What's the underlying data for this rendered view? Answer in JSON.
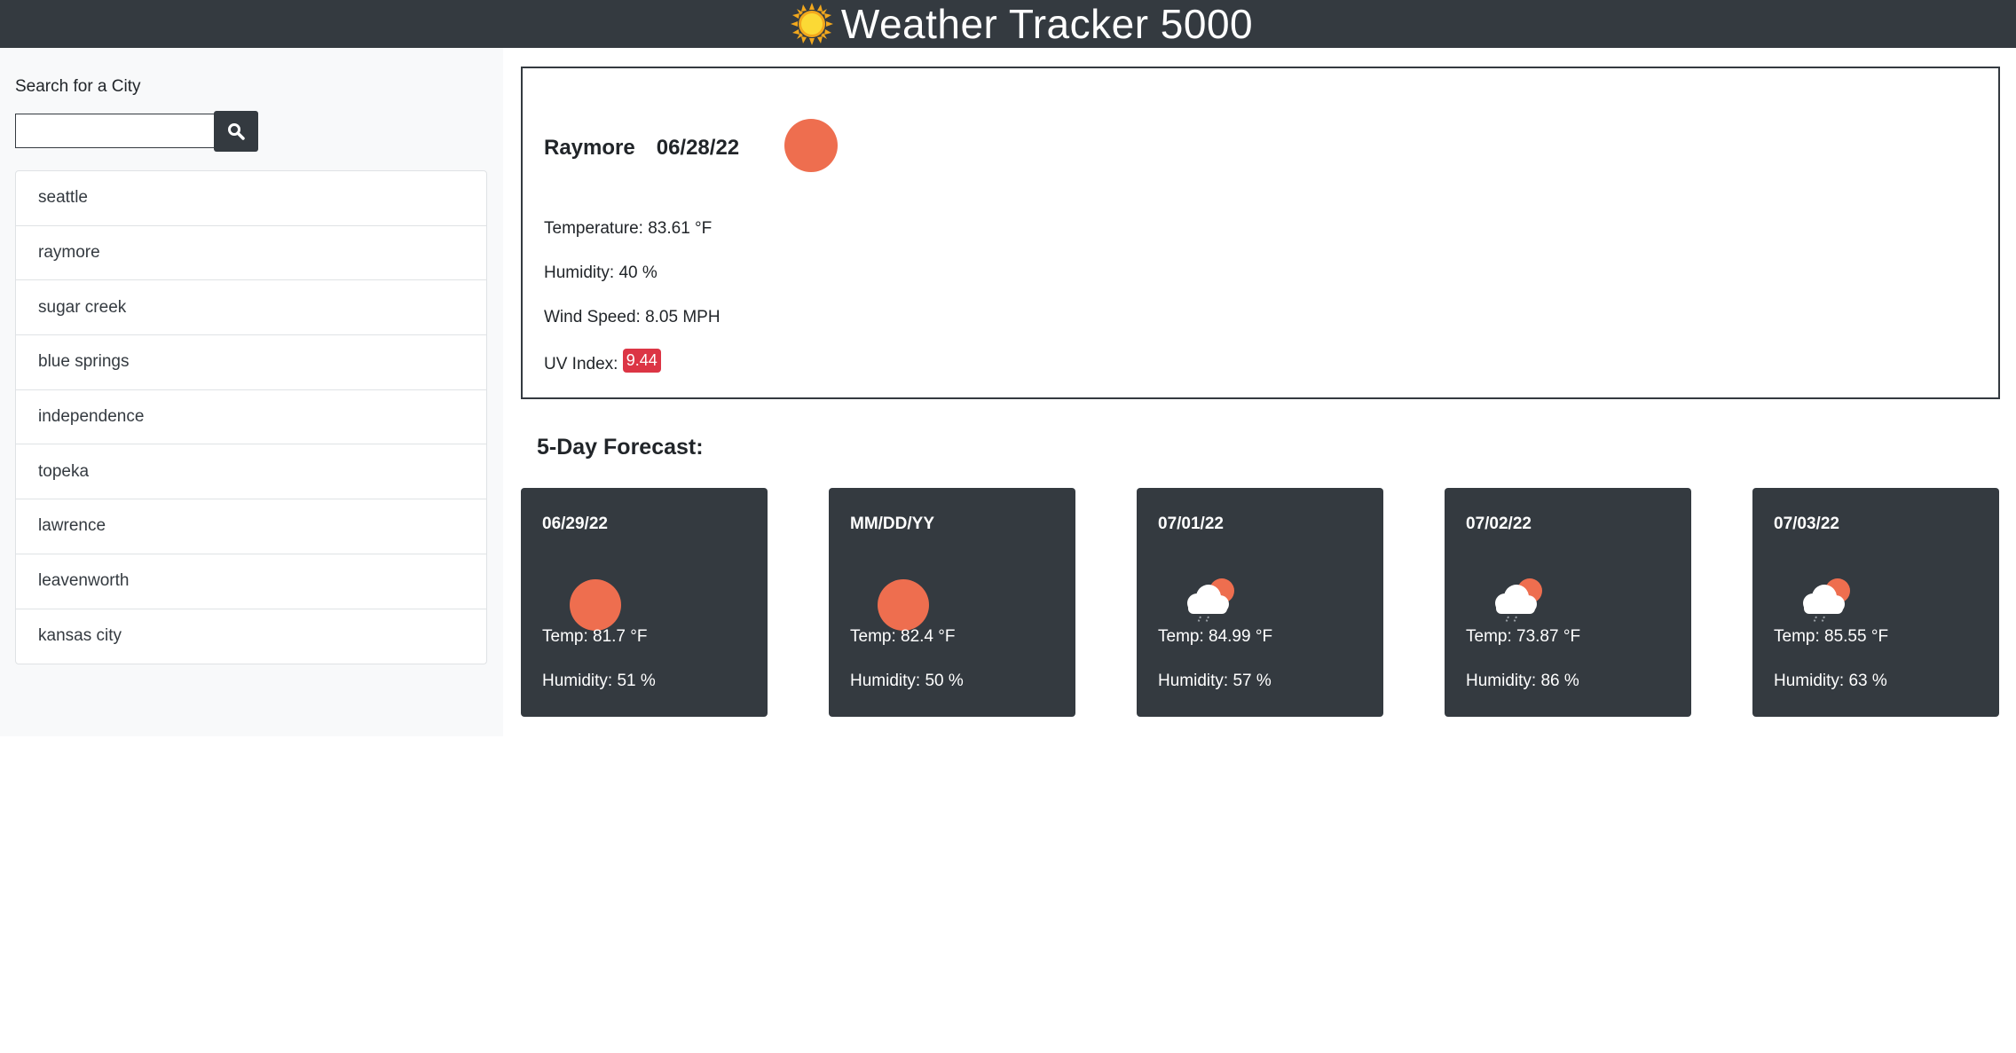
{
  "header": {
    "title": "Weather Tracker 5000",
    "logo_icon": "sun-icon"
  },
  "sidebar": {
    "search_label": "Search for a City",
    "search_value": "",
    "search_placeholder": "",
    "search_icon": "search-icon",
    "cities": [
      {
        "label": "seattle"
      },
      {
        "label": "raymore"
      },
      {
        "label": "sugar creek"
      },
      {
        "label": "blue springs"
      },
      {
        "label": "independence"
      },
      {
        "label": "topeka"
      },
      {
        "label": "lawrence"
      },
      {
        "label": "leavenworth"
      },
      {
        "label": "kansas city"
      }
    ]
  },
  "current": {
    "city": "Raymore",
    "date": "06/28/22",
    "icon": "clear-sun-icon",
    "temperature": "Temperature: 83.61 °F",
    "humidity": "Humidity: 40 %",
    "wind": "Wind Speed: 8.05 MPH",
    "uv_label": "UV Index:",
    "uv_value": "9.44",
    "uv_color": "#dc3545"
  },
  "forecast": {
    "title": "5-Day Forecast:",
    "days": [
      {
        "date": "06/29/22",
        "icon": "clear-sun-icon",
        "temp": "Temp: 81.7 °F",
        "humidity": "Humidity: 51 %"
      },
      {
        "date": "MM/DD/YY",
        "icon": "clear-sun-icon",
        "temp": "Temp: 82.4 °F",
        "humidity": "Humidity: 50 %"
      },
      {
        "date": "07/01/22",
        "icon": "rain-cloud-sun-icon",
        "temp": "Temp: 84.99 °F",
        "humidity": "Humidity: 57 %"
      },
      {
        "date": "07/02/22",
        "icon": "rain-cloud-sun-icon",
        "temp": "Temp: 73.87 °F",
        "humidity": "Humidity: 86 %"
      },
      {
        "date": "07/03/22",
        "icon": "rain-cloud-sun-icon",
        "temp": "Temp: 85.55 °F",
        "humidity": "Humidity: 63 %"
      }
    ]
  },
  "colors": {
    "header_bg": "#343a40",
    "sun": "#ee6e4f",
    "card_bg": "#343a40"
  }
}
